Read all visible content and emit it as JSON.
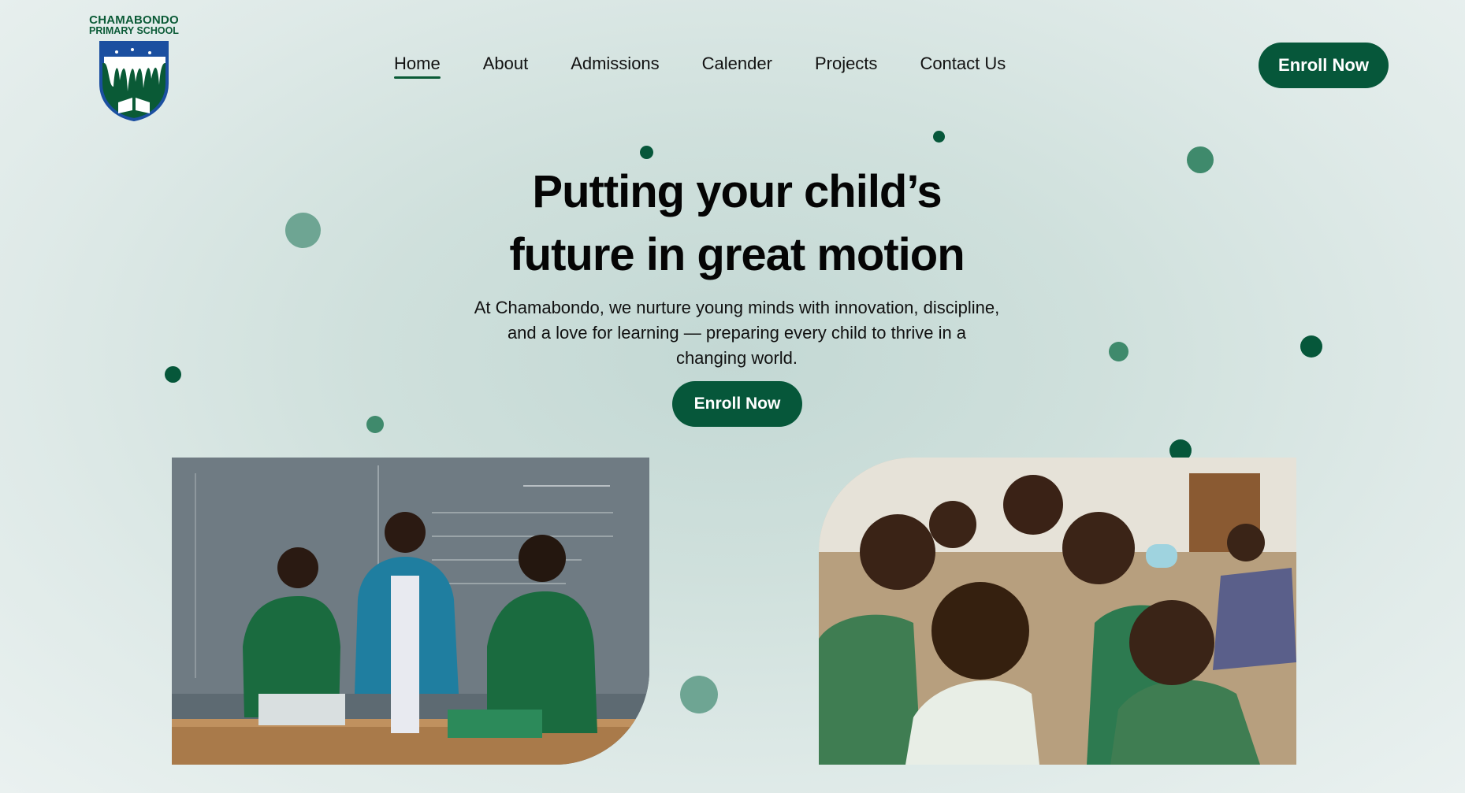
{
  "brand": {
    "name": "CHAMABONDO",
    "subtitle": "PRIMARY SCHOOL",
    "logo_icon": "school-crest-icon",
    "color": "#0a5a36"
  },
  "nav": {
    "items": [
      {
        "label": "Home",
        "active": true
      },
      {
        "label": "About",
        "active": false
      },
      {
        "label": "Admissions",
        "active": false
      },
      {
        "label": "Calender",
        "active": false
      },
      {
        "label": "Projects",
        "active": false
      },
      {
        "label": "Contact Us",
        "active": false
      }
    ],
    "cta_label": "Enroll Now"
  },
  "hero": {
    "title_line1": "Putting your child’s",
    "title_line2": "future in great motion",
    "subtitle": "At Chamabondo, we nurture young minds with innovation, discipline, and a love for learning — preparing every child to thrive in a changing world.",
    "cta_label": "Enroll Now"
  },
  "images": {
    "left": "classroom-photo-teacher-with-students",
    "right": "group-of-smiling-students-photo"
  },
  "colors": {
    "accent": "#06573a",
    "dot_medium": "#3f8a6c",
    "dot_light": "#6ea593",
    "background": "#cfe0dc"
  }
}
